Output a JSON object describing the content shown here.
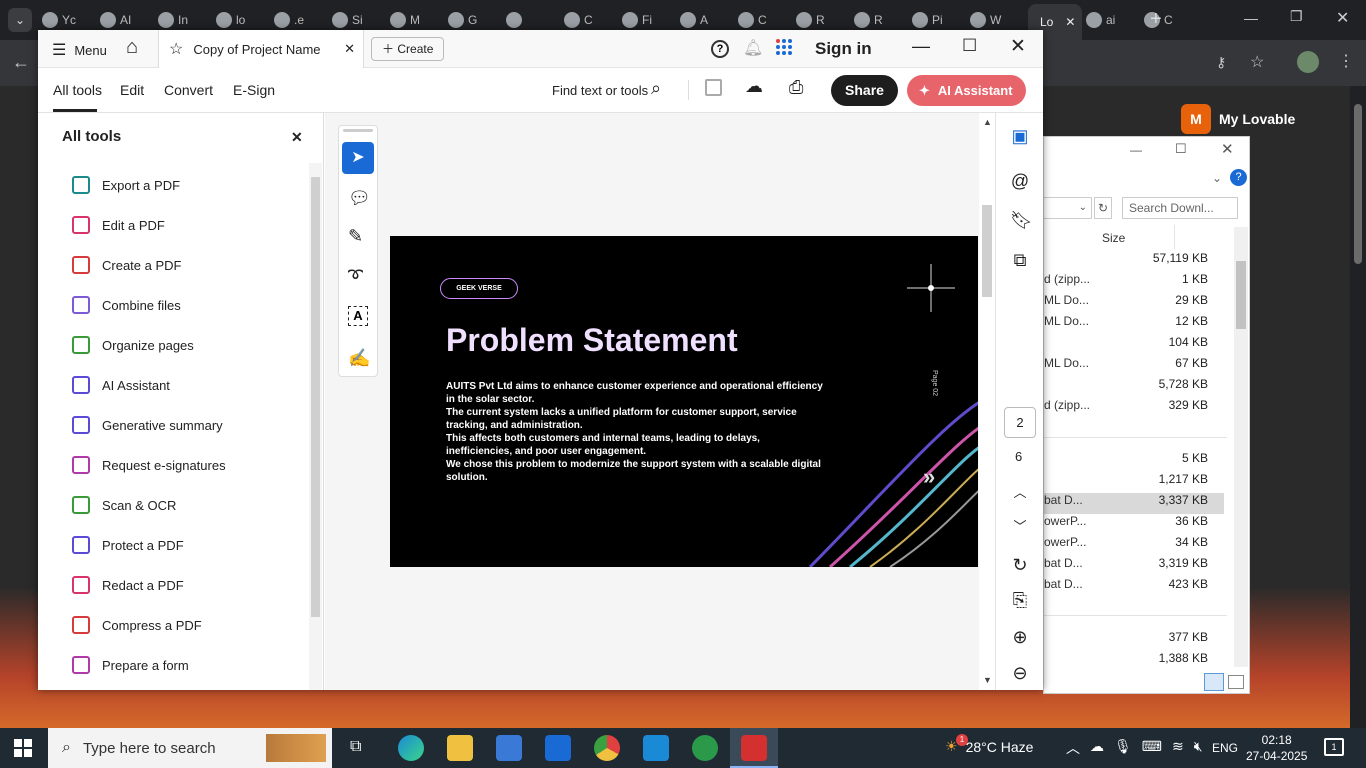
{
  "browser": {
    "tabs": [
      "Yc",
      "AI",
      "In",
      "lo",
      ".e",
      "Si",
      "M",
      "G",
      "",
      "C",
      "Fi",
      "A",
      "C",
      "R",
      "R",
      "Pi",
      "W",
      "Lo",
      "ai",
      "C"
    ],
    "active_tab_label": "Lo"
  },
  "lovable": {
    "initial": "M",
    "label": "My Lovable"
  },
  "explorer": {
    "search_placeholder": "Search Downl...",
    "size_header": "Size",
    "rows": [
      {
        "name": "",
        "size": "57,119 KB"
      },
      {
        "name": "d (zipp...",
        "size": "1 KB"
      },
      {
        "name": "ML Do...",
        "size": "29 KB"
      },
      {
        "name": "ML Do...",
        "size": "12 KB"
      },
      {
        "name": "",
        "size": "104 KB"
      },
      {
        "name": "ML Do...",
        "size": "67 KB"
      },
      {
        "name": "",
        "size": "5,728 KB"
      },
      {
        "name": "d (zipp...",
        "size": "329 KB"
      },
      {
        "name": "",
        "size": "5 KB"
      },
      {
        "name": "",
        "size": "1,217 KB"
      },
      {
        "name": "bat D...",
        "size": "3,337 KB"
      },
      {
        "name": "owerP...",
        "size": "36 KB"
      },
      {
        "name": "owerP...",
        "size": "34 KB"
      },
      {
        "name": "bat D...",
        "size": "3,319 KB"
      },
      {
        "name": "bat D...",
        "size": "423 KB"
      },
      {
        "name": "",
        "size": "377 KB"
      },
      {
        "name": "",
        "size": "1,388 KB"
      }
    ]
  },
  "acrobat": {
    "menu_label": "Menu",
    "doc_tab": "Copy of Project Name",
    "create_label": "Create",
    "sign_in": "Sign in",
    "toolbar_tabs": [
      "All tools",
      "Edit",
      "Convert",
      "E-Sign"
    ],
    "find_label": "Find text or tools",
    "share_label": "Share",
    "ai_label": "AI Assistant",
    "panel_title": "All tools",
    "tools": [
      {
        "label": "Export a PDF",
        "color": "#1a8a8a"
      },
      {
        "label": "Edit a PDF",
        "color": "#d7336c"
      },
      {
        "label": "Create a PDF",
        "color": "#d43c3c"
      },
      {
        "label": "Combine files",
        "color": "#7b5bd6"
      },
      {
        "label": "Organize pages",
        "color": "#3a9a3a"
      },
      {
        "label": "AI Assistant",
        "color": "#5a4ad6"
      },
      {
        "label": "Generative summary",
        "color": "#5a4ad6"
      },
      {
        "label": "Request e-signatures",
        "color": "#b03aa8"
      },
      {
        "label": "Scan & OCR",
        "color": "#3a9a3a"
      },
      {
        "label": "Protect a PDF",
        "color": "#5a4ad6"
      },
      {
        "label": "Redact a PDF",
        "color": "#d7336c"
      },
      {
        "label": "Compress a PDF",
        "color": "#d43c3c"
      },
      {
        "label": "Prepare a form",
        "color": "#b03aa8"
      }
    ],
    "page_current": "2",
    "page_total": "6"
  },
  "slide": {
    "badge": "GEEK VERSE",
    "title": "Problem Statement",
    "page_tag": "Page 02",
    "lines": [
      "AUITS Pvt Ltd aims to enhance customer experience and operational efficiency",
      "in the solar sector.",
      "The current system lacks a unified platform for customer support, service",
      "tracking, and administration.",
      "This affects both customers and internal teams, leading to delays,",
      "inefficiencies, and poor user engagement.",
      "We chose this problem to modernize the support system with a scalable digital",
      "solution."
    ]
  },
  "taskbar": {
    "search_placeholder": "Type here to search",
    "weather": "28°C  Haze",
    "weather_badge": "1",
    "lang": "ENG",
    "time": "02:18",
    "date": "27-04-2025",
    "notif": "1"
  }
}
